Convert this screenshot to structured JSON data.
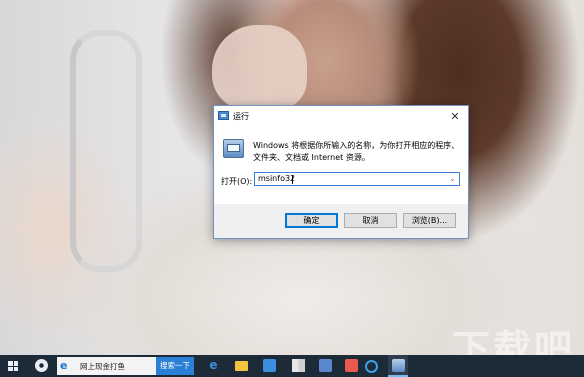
{
  "dialog": {
    "title": "运行",
    "description": "Windows 将根据你所输入的名称，为你打开相应的程序、文件夹、文档或 Internet 资源。",
    "open_label": "打开(O):",
    "open_value": "msinfo32",
    "close_glyph": "✕",
    "dropdown_glyph": "⌄",
    "buttons": {
      "ok": "确定",
      "cancel": "取消",
      "browse": "浏览(B)..."
    }
  },
  "taskbar": {
    "search_placeholder": "网上现金打鱼",
    "search_button": "搜索一下",
    "search_logo": "e",
    "apps": [
      "edge-icon",
      "file-explorer-icon",
      "store-icon",
      "app-grid-icon",
      "bird-app-icon",
      "image-app-icon",
      "circle-app-icon",
      "run-icon"
    ]
  },
  "wallpaper": {
    "watermark": "下载吧"
  },
  "colors": {
    "taskbar_bg": "#1d2a38",
    "accent": "#0078d7",
    "search_button_bg": "#2b7fd7"
  }
}
